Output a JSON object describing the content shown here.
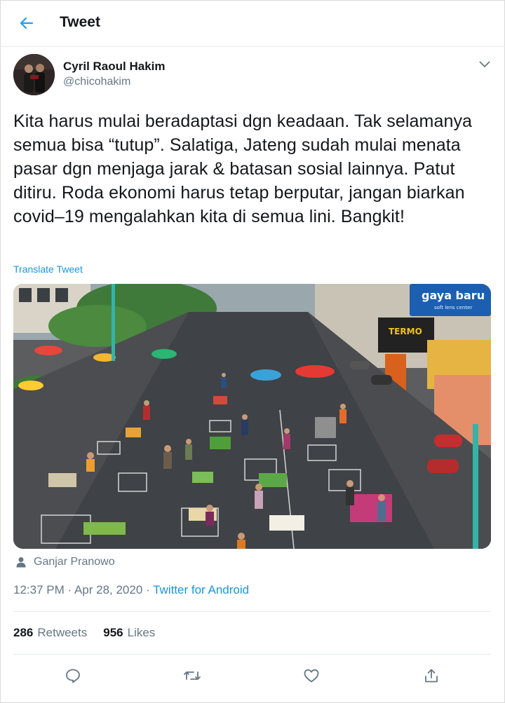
{
  "header": {
    "title": "Tweet",
    "back_icon": "arrow-left-icon"
  },
  "author": {
    "name": "Cyril Raoul Hakim",
    "handle": "@chicohakim"
  },
  "tweet": {
    "text": "Kita harus mulai beradaptasi dgn keadaan. Tak selamanya semua bisa “tutup”. Salatiga, Jateng sudah mulai menata pasar dgn menjaga jarak & batasan sosial lainnya. Patut ditiru. Roda ekonomi harus tetap berputar, jangan biarkan covid–19 mengalahkan kita di semua lini. Bangkit!",
    "translate_label": "Translate Tweet"
  },
  "media": {
    "shop_sign_1": "gaya baru",
    "shop_sign_1_sub": "soft lens center",
    "shop_sign_2": "TERMO"
  },
  "media_credit": "Ganjar Pranowo",
  "meta": {
    "time": "12:37 PM",
    "separator": " · ",
    "date": "Apr 28, 2020",
    "source": "Twitter for Android"
  },
  "stats": {
    "retweets_count": "286",
    "retweets_label": "Retweets",
    "likes_count": "956",
    "likes_label": "Likes"
  },
  "colors": {
    "accent": "#1da1f2",
    "link": "#1b95e0",
    "muted": "#657786"
  }
}
